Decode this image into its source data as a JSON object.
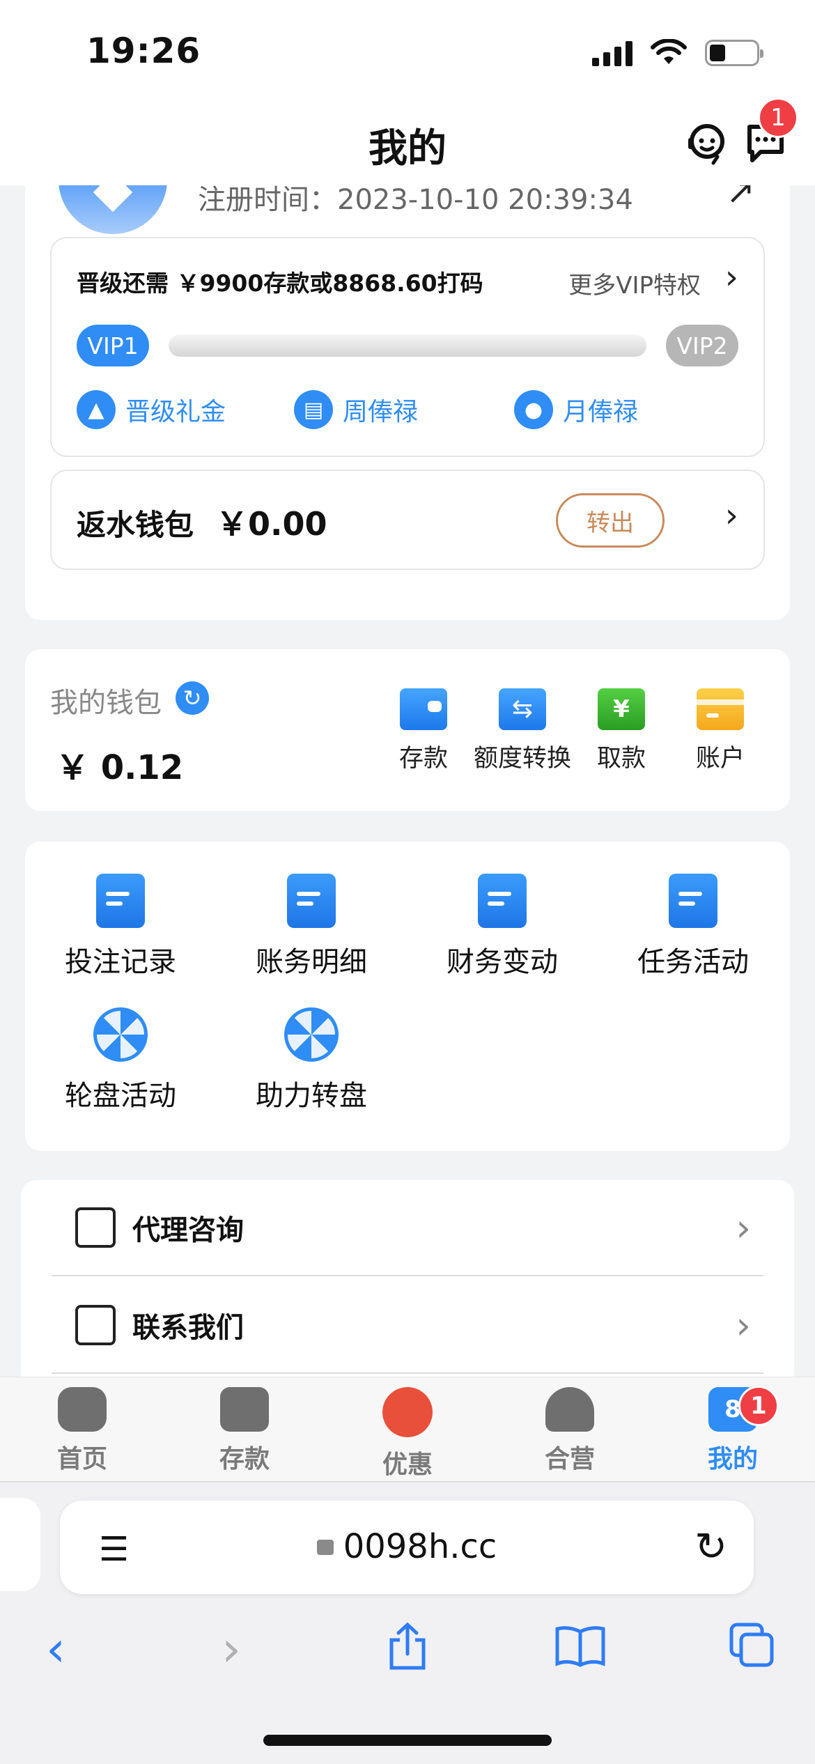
{
  "status_bar": {
    "time": "19:26"
  },
  "header": {
    "title": "我的",
    "message_badge": "1"
  },
  "profile": {
    "reg_label": "注册时间：",
    "reg_time": "2023-10-10 20:39:34",
    "vip": {
      "upgrade_text": "晋级还需 ￥9900存款或8868.60打码",
      "more_label": "更多VIP特权",
      "current_level": "VIP1",
      "next_level": "VIP2",
      "progress": 0,
      "perks": [
        "晋级礼金",
        "周俸禄",
        "月俸禄"
      ]
    },
    "rebate": {
      "label": "返水钱包",
      "amount": "￥0.00",
      "button": "转出"
    }
  },
  "wallet": {
    "label": "我的钱包",
    "amount": "￥ 0.12",
    "actions": [
      {
        "label": "存款",
        "icon": "deposit-icon",
        "color": "#2f8df5"
      },
      {
        "label": "额度转换",
        "icon": "transfer-icon",
        "color": "#2f8df5"
      },
      {
        "label": "取款",
        "icon": "withdraw-icon",
        "color": "#3cb32f"
      },
      {
        "label": "账户",
        "icon": "account-icon",
        "color": "#f7b827"
      }
    ]
  },
  "features": [
    {
      "label": "投注记录",
      "icon": "bet-record-icon"
    },
    {
      "label": "账务明细",
      "icon": "account-detail-icon"
    },
    {
      "label": "财务变动",
      "icon": "finance-change-icon"
    },
    {
      "label": "任务活动",
      "icon": "task-activity-icon"
    },
    {
      "label": "轮盘活动",
      "icon": "roulette-icon"
    },
    {
      "label": "助力转盘",
      "icon": "boost-wheel-icon"
    }
  ],
  "menu": [
    {
      "label": "代理咨询",
      "icon": "agent-consult-icon"
    },
    {
      "label": "联系我们",
      "icon": "contact-icon"
    }
  ],
  "tabbar": {
    "items": [
      {
        "label": "首页",
        "icon": "gamepad-icon"
      },
      {
        "label": "存款",
        "icon": "wallet-icon"
      },
      {
        "label": "优惠",
        "icon": "gift-icon"
      },
      {
        "label": "合营",
        "icon": "partner-icon"
      },
      {
        "label": "我的",
        "icon": "profile-shirt-icon",
        "badge": "1",
        "shirt_number": "8"
      }
    ],
    "active_index": 4,
    "active_color": "#2f8df5"
  },
  "browser": {
    "url": "0098h.cc"
  }
}
